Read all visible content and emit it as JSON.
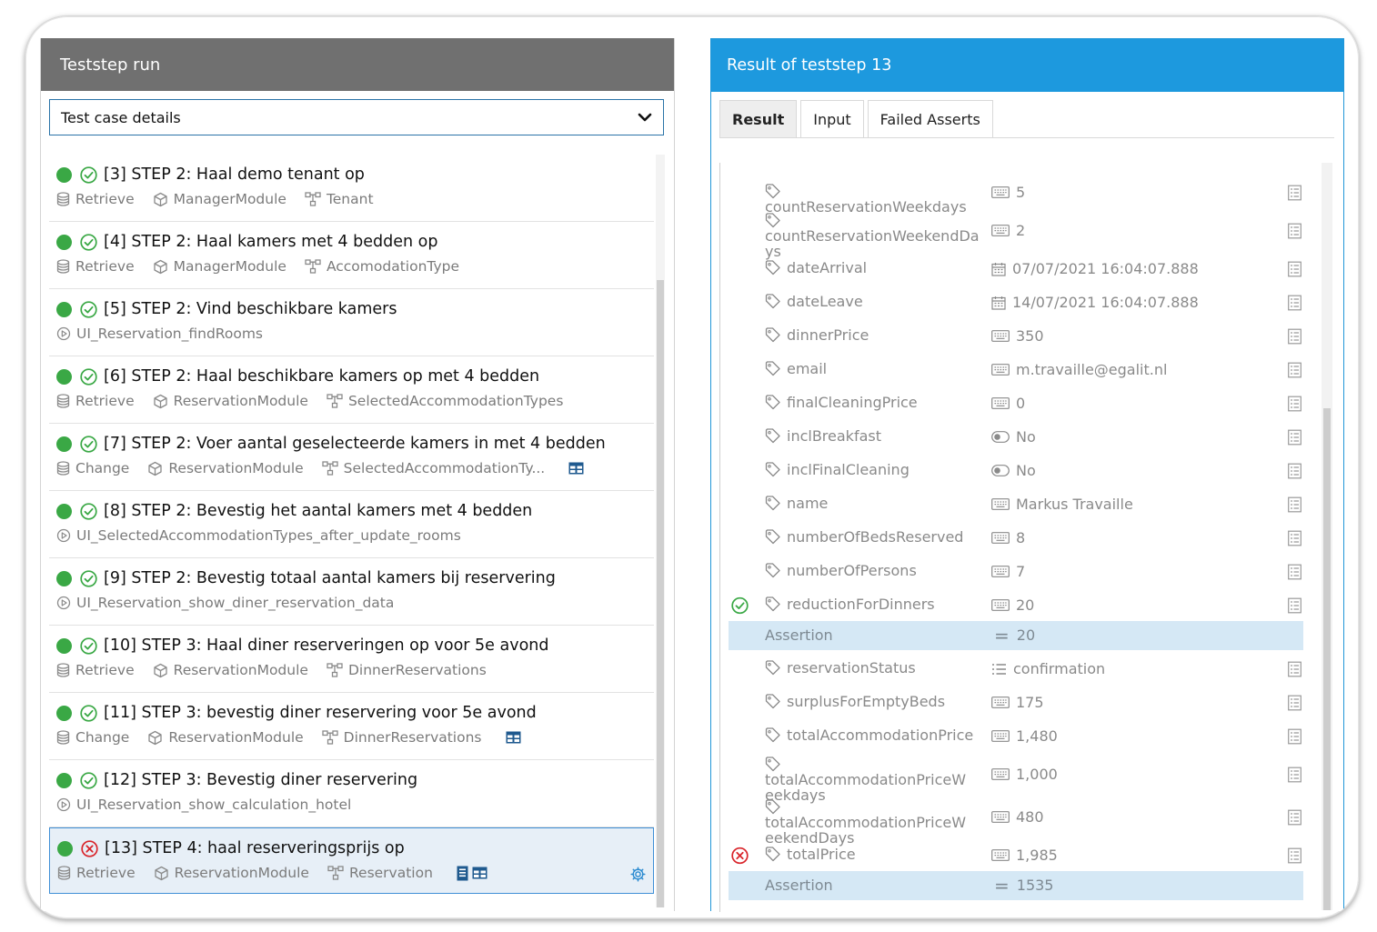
{
  "left": {
    "title": "Teststep run",
    "select_value": "Test case details",
    "steps": [
      {
        "title": "[3] STEP 2: Haal demo tenant op",
        "status": "pass",
        "meta": [
          {
            "icon": "database-icon",
            "text": "Retrieve"
          },
          {
            "icon": "cube-icon",
            "text": "ManagerModule"
          },
          {
            "icon": "entity-icon",
            "text": "Tenant"
          }
        ]
      },
      {
        "title": "[4] STEP 2: Haal kamers met 4 bedden op",
        "status": "pass",
        "meta": [
          {
            "icon": "database-icon",
            "text": "Retrieve"
          },
          {
            "icon": "cube-icon",
            "text": "ManagerModule"
          },
          {
            "icon": "entity-icon",
            "text": "AccomodationType"
          }
        ]
      },
      {
        "title": "[5] STEP 2: Vind beschikbare kamers",
        "status": "pass",
        "meta": [
          {
            "icon": "play-icon",
            "text": "UI_Reservation_findRooms"
          }
        ]
      },
      {
        "title": "[6] STEP 2: Haal beschikbare kamers op met 4 bedden",
        "status": "pass",
        "meta": [
          {
            "icon": "database-icon",
            "text": "Retrieve"
          },
          {
            "icon": "cube-icon",
            "text": "ReservationModule"
          },
          {
            "icon": "entity-icon",
            "text": "SelectedAccommodationTypes"
          }
        ]
      },
      {
        "title": "[7] STEP 2: Voer aantal geselecteerde kamers in met 4 bedden",
        "status": "pass",
        "meta": [
          {
            "icon": "database-icon",
            "text": "Change"
          },
          {
            "icon": "cube-icon",
            "text": "ReservationModule"
          },
          {
            "icon": "entity-icon",
            "text": "SelectedAccommodationTy..."
          }
        ],
        "extra": [
          "table-icon"
        ]
      },
      {
        "title": "[8] STEP 2: Bevestig het aantal kamers met 4 bedden",
        "status": "pass",
        "meta": [
          {
            "icon": "play-icon",
            "text": "UI_SelectedAccommodationTypes_after_update_rooms"
          }
        ]
      },
      {
        "title": "[9] STEP 2: Bevestig totaal aantal kamers bij reservering",
        "status": "pass",
        "meta": [
          {
            "icon": "play-icon",
            "text": "UI_Reservation_show_diner_reservation_data"
          }
        ]
      },
      {
        "title": "[10] STEP 3: Haal diner reserveringen op voor 5e avond",
        "status": "pass",
        "meta": [
          {
            "icon": "database-icon",
            "text": "Retrieve"
          },
          {
            "icon": "cube-icon",
            "text": "ReservationModule"
          },
          {
            "icon": "entity-icon",
            "text": "DinnerReservations"
          }
        ]
      },
      {
        "title": "[11] STEP 3: bevestig diner reservering voor 5e avond",
        "status": "pass",
        "meta": [
          {
            "icon": "database-icon",
            "text": "Change"
          },
          {
            "icon": "cube-icon",
            "text": "ReservationModule"
          },
          {
            "icon": "entity-icon",
            "text": "DinnerReservations"
          }
        ],
        "extra": [
          "table-icon"
        ]
      },
      {
        "title": "[12] STEP 3: Bevestig diner reservering",
        "status": "pass",
        "meta": [
          {
            "icon": "play-icon",
            "text": "UI_Reservation_show_calculation_hotel"
          }
        ]
      },
      {
        "title": "[13] STEP 4: haal reserveringsprijs op",
        "status": "fail",
        "selected": true,
        "meta": [
          {
            "icon": "database-icon",
            "text": "Retrieve"
          },
          {
            "icon": "cube-icon",
            "text": "ReservationModule"
          },
          {
            "icon": "entity-icon",
            "text": "Reservation"
          }
        ],
        "extra": [
          "document-icon",
          "table-icon"
        ]
      }
    ]
  },
  "right": {
    "title": "Result of teststep 13",
    "tabs": [
      "Result",
      "Input",
      "Failed Asserts"
    ],
    "assertion_label": "Assertion",
    "rows": [
      {
        "name": "countReservationWeekdays",
        "type": "keyboard-icon",
        "value": "5"
      },
      {
        "name": "countReservationWeekendDa",
        "name2": "ys",
        "type": "keyboard-icon",
        "value": "2"
      },
      {
        "name": "dateArrival",
        "type": "calendar-icon",
        "value": "07/07/2021 16:04:07.888"
      },
      {
        "name": "dateLeave",
        "type": "calendar-icon",
        "value": "14/07/2021 16:04:07.888"
      },
      {
        "name": "dinnerPrice",
        "type": "keyboard-icon",
        "value": "350"
      },
      {
        "name": "email",
        "type": "keyboard-icon",
        "value": "m.travaille@egalit.nl"
      },
      {
        "name": "finalCleaningPrice",
        "type": "keyboard-icon",
        "value": "0"
      },
      {
        "name": "inclBreakfast",
        "type": "toggle-icon",
        "value": "No"
      },
      {
        "name": "inclFinalCleaning",
        "type": "toggle-icon",
        "value": "No"
      },
      {
        "name": "name",
        "type": "keyboard-icon",
        "value": "Markus Travaille"
      },
      {
        "name": "numberOfBedsReserved",
        "type": "keyboard-icon",
        "value": "8"
      },
      {
        "name": "numberOfPersons",
        "type": "keyboard-icon",
        "value": "7"
      },
      {
        "name": "reductionForDinners",
        "type": "keyboard-icon",
        "value": "20",
        "status": "pass",
        "assertion": "20"
      },
      {
        "name": "reservationStatus",
        "type": "list-icon",
        "value": "confirmation"
      },
      {
        "name": "surplusForEmptyBeds",
        "type": "keyboard-icon",
        "value": "175"
      },
      {
        "name": "totalAccommodationPrice",
        "type": "keyboard-icon",
        "value": "1,480"
      },
      {
        "name": "totalAccommodationPriceW",
        "name2": "eekdays",
        "type": "keyboard-icon",
        "value": "1,000"
      },
      {
        "name": "totalAccommodationPriceW",
        "name2": "eekendDays",
        "type": "keyboard-icon",
        "value": "480"
      },
      {
        "name": "totalPrice",
        "type": "keyboard-icon",
        "value": "1,985",
        "status": "fail",
        "assertion": "1535"
      }
    ]
  },
  "colors": {
    "pass": "#3aa845",
    "fail": "#d9252b",
    "accent": "#1d99de"
  }
}
